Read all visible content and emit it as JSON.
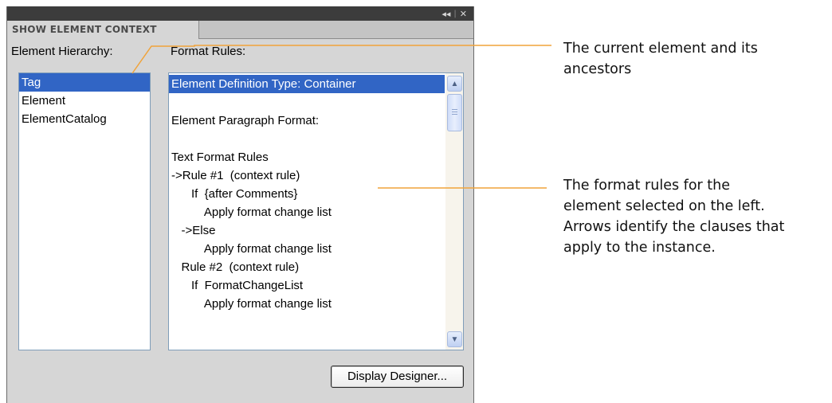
{
  "panel": {
    "title_controls": {
      "collapse_icon": "double-left-arrow",
      "close_icon": "close-x"
    },
    "tab_label": "SHOW ELEMENT CONTEXT",
    "hierarchy_label": "Element Hierarchy:",
    "hierarchy_items": [
      "Tag",
      "Element",
      "ElementCatalog"
    ],
    "rules_label": "Format Rules:",
    "rules_lines": [
      "Element Definition Type: Container",
      "",
      "Element Paragraph Format:",
      "",
      "Text Format Rules",
      "->Rule #1  (context rule)",
      "      If  {after Comments}",
      "          Apply format change list",
      "   ->Else",
      "          Apply format change list",
      "   Rule #2  (context rule)",
      "      If  FormatChangeList",
      "          Apply format change list"
    ],
    "display_designer_label": "Display Designer..."
  },
  "callouts": {
    "top": [
      "The current element and its",
      "ancestors"
    ],
    "middle": [
      "The format rules for the",
      "element selected on the left.",
      "Arrows identify the clauses that",
      "apply to the instance."
    ]
  },
  "colors": {
    "callout_line": "#f0a33a",
    "selection": "#3165c5",
    "titlebar": "#3c3c3c"
  }
}
